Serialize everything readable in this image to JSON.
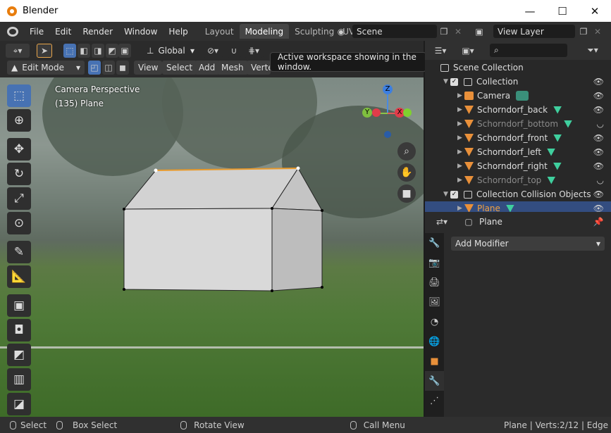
{
  "window": {
    "title": "Blender",
    "btn_min": "—",
    "btn_max": "☐",
    "btn_close": "✕"
  },
  "menu": [
    "File",
    "Edit",
    "Render",
    "Window",
    "Help"
  ],
  "workspaces": [
    "Layout",
    "Modeling",
    "Sculpting",
    "UV"
  ],
  "scene": {
    "label": "Scene",
    "view_layer": "View Layer"
  },
  "header": {
    "transform": "Global",
    "mode": "Edit Mode",
    "menus": [
      "View",
      "Select",
      "Add",
      "Mesh",
      "Vertex"
    ]
  },
  "tooltip": "Active workspace showing in the window.",
  "viewport": {
    "perspective": "Camera Perspective",
    "object": "(135) Plane"
  },
  "gizmo": {
    "z": "Z",
    "y": "Y",
    "x": "X"
  },
  "outliner": {
    "root": "Scene Collection",
    "rows": [
      {
        "label": "Collection",
        "type": "collection",
        "indent": 1
      },
      {
        "label": "Camera",
        "type": "camera",
        "indent": 2
      },
      {
        "label": "Schorndorf_back",
        "type": "mesh",
        "indent": 2
      },
      {
        "label": "Schorndorf_bottom",
        "type": "mesh",
        "indent": 2,
        "dim": true
      },
      {
        "label": "Schorndorf_front",
        "type": "mesh",
        "indent": 2
      },
      {
        "label": "Schorndorf_left",
        "type": "mesh",
        "indent": 2
      },
      {
        "label": "Schorndorf_right",
        "type": "mesh",
        "indent": 2
      },
      {
        "label": "Schorndorf_top",
        "type": "mesh",
        "indent": 2,
        "dim": true
      },
      {
        "label": "Collection Collision Objects",
        "type": "collection",
        "indent": 1
      },
      {
        "label": "Plane",
        "type": "mesh",
        "indent": 2,
        "selected": true
      }
    ]
  },
  "properties": {
    "object": "Plane",
    "add_modifier": "Add Modifier"
  },
  "status": {
    "select": "Select",
    "box_select": "Box Select",
    "rotate_view": "Rotate View",
    "call_menu": "Call Menu",
    "stats": "Plane | Verts:2/12 | Edge"
  }
}
